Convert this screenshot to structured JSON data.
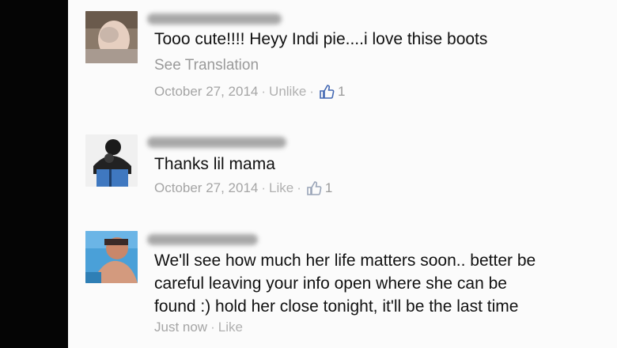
{
  "comments": [
    {
      "text": "Tooo cute!!!! Heyy Indi pie....i love thise boots",
      "translation_link": "See Translation",
      "timestamp": "October 27, 2014",
      "action": "Unlike",
      "like_count": "1"
    },
    {
      "text": "Thanks lil mama",
      "timestamp": "October 27, 2014",
      "action": "Like",
      "like_count": "1"
    },
    {
      "text": "We'll see how much her life matters soon.. better be\ncareful leaving your info open where she can be\nfound :) hold her close tonight, it'll be the last time",
      "timestamp": "Just now",
      "action": "Like"
    }
  ],
  "meta_separator": "·",
  "colors": {
    "like_blue": "#4267b2",
    "meta_gray": "#a5a5a5",
    "text": "#111111"
  }
}
